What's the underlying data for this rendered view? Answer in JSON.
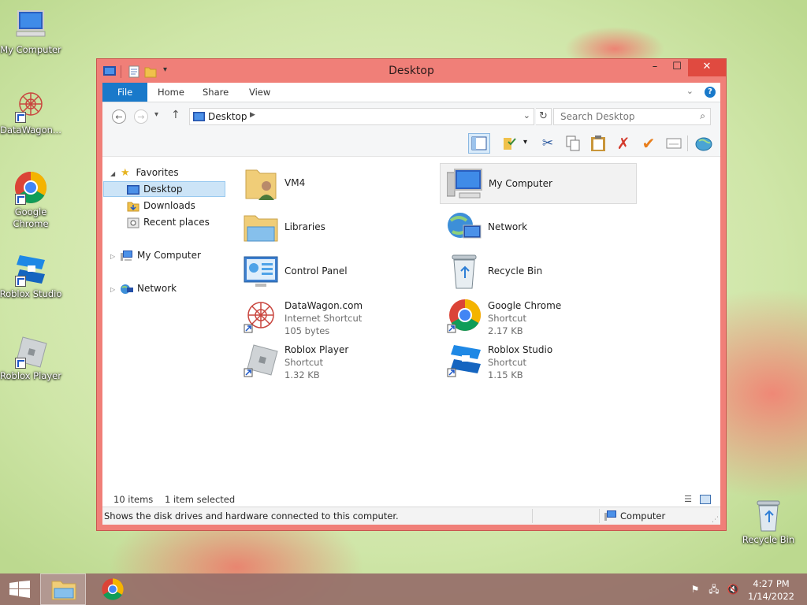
{
  "desktop": {
    "icons": [
      {
        "label": "My Computer"
      },
      {
        "label": "DataWagon..."
      },
      {
        "label": "Google Chrome"
      },
      {
        "label": "Roblox Studio"
      },
      {
        "label": "Roblox Player"
      },
      {
        "label": "Recycle Bin"
      }
    ]
  },
  "window": {
    "title": "Desktop",
    "controls": {
      "minimize": "–",
      "maximize": "☐",
      "close": "✕"
    }
  },
  "ribbon": {
    "tabs": [
      "File",
      "Home",
      "Share",
      "View"
    ]
  },
  "address": {
    "path": "Desktop",
    "search_placeholder": "Search Desktop"
  },
  "nav_pane": {
    "favorites_label": "Favorites",
    "favorites": [
      "Desktop",
      "Downloads",
      "Recent places"
    ],
    "computer_label": "My Computer",
    "network_label": "Network"
  },
  "items": [
    {
      "name": "VM4",
      "sub1": "",
      "sub2": ""
    },
    {
      "name": "My Computer",
      "sub1": "",
      "sub2": ""
    },
    {
      "name": "Libraries",
      "sub1": "",
      "sub2": ""
    },
    {
      "name": "Network",
      "sub1": "",
      "sub2": ""
    },
    {
      "name": "Control Panel",
      "sub1": "",
      "sub2": ""
    },
    {
      "name": "Recycle Bin",
      "sub1": "",
      "sub2": ""
    },
    {
      "name": "DataWagon.com",
      "sub1": "Internet Shortcut",
      "sub2": "105 bytes"
    },
    {
      "name": "Google Chrome",
      "sub1": "Shortcut",
      "sub2": "2.17 KB"
    },
    {
      "name": "Roblox Player",
      "sub1": "Shortcut",
      "sub2": "1.32 KB"
    },
    {
      "name": "Roblox Studio",
      "sub1": "Shortcut",
      "sub2": "1.15 KB"
    }
  ],
  "status": {
    "item_count": "10 items",
    "selection": "1 item selected",
    "description": "Shows the disk drives and hardware connected to this computer.",
    "zone": "Computer"
  },
  "taskbar": {
    "time": "4:27 PM",
    "date": "1/14/2022"
  },
  "colors": {
    "window_frame": "#f07f78",
    "close_button": "#e04a40",
    "file_tab": "#1979ca",
    "selection": "#cce4f7"
  }
}
